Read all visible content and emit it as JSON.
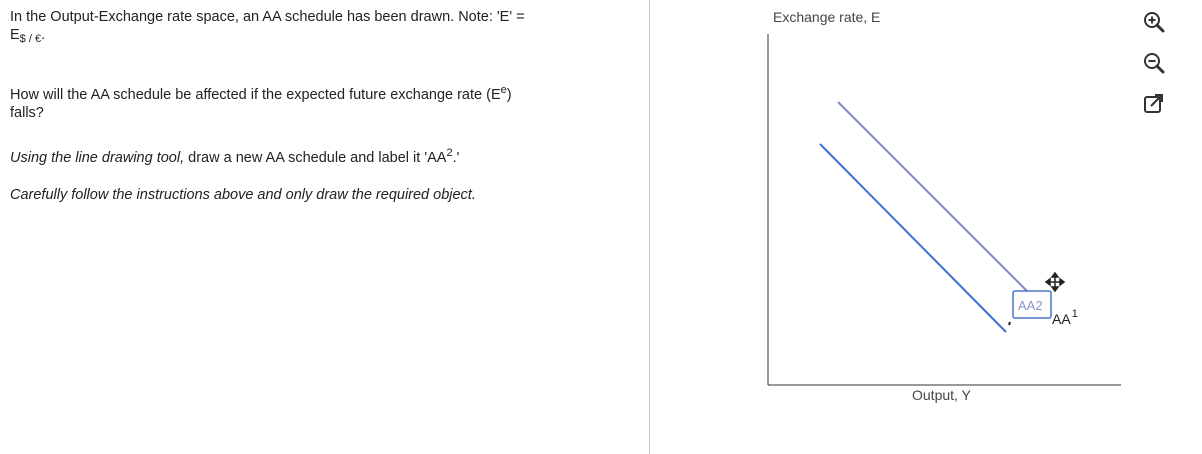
{
  "question": {
    "line1": "In the Output-Exchange rate space, an AA schedule has been drawn. Note: 'E' =",
    "e_symbol": "E",
    "e_subscript": "$ / €",
    "e_trailing": ".",
    "q_before": "How will the AA schedule be affected if the expected future exchange rate (E",
    "q_sup": "e",
    "q_after": ")",
    "q_line2": "falls?",
    "instr_italic": "Using the line drawing tool,",
    "instr_rest": " draw a new AA schedule and label it 'AA",
    "instr_sup": "2",
    "instr_end": ".'",
    "careful": "Carefully follow the instructions above and only draw the required object."
  },
  "graph": {
    "y_axis_label": "Exchange rate, E",
    "x_axis_label": "Output, Y",
    "aa1_label": "AA",
    "aa1_sup": "1",
    "aa2_label": "AA2",
    "colors": {
      "axis": "#333333",
      "aa1_line": "#3b6fd6",
      "aa2_line": "#8088bd",
      "label_box": "#4a76c9"
    }
  },
  "toolbar": {
    "zoom_in": "zoom-in-icon",
    "zoom_out": "zoom-out-icon",
    "popout": "popout-icon"
  }
}
